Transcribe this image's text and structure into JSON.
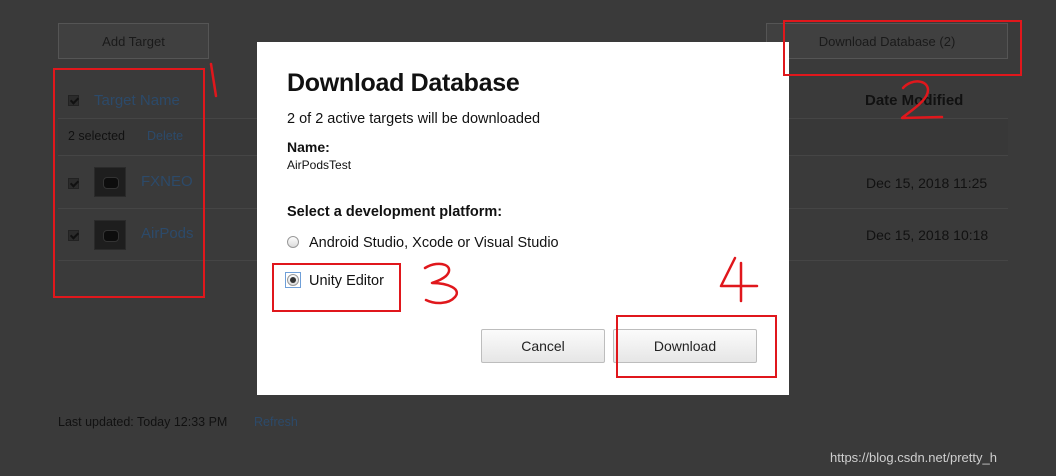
{
  "page": {
    "add_target_label": "Add Target",
    "download_database_label": "Download Database (2)",
    "column_target_name": "Target Name",
    "column_date_modified": "Date Modified",
    "selected_count": "2 selected",
    "delete_label": "Delete",
    "rows": [
      {
        "name": "FXNEO",
        "date": "Dec 15, 2018 11:25"
      },
      {
        "name": "AirPods",
        "date": "Dec 15, 2018 10:18"
      }
    ],
    "last_updated": "Last updated: Today 12:33 PM",
    "refresh_label": "Refresh"
  },
  "modal": {
    "title": "Download Database",
    "subtitle": "2 of 2 active targets will be downloaded",
    "name_label": "Name:",
    "name_value": "AirPodsTest",
    "platform_label": "Select a development platform:",
    "options": [
      {
        "label": "Android Studio, Xcode or Visual Studio",
        "selected": false
      },
      {
        "label": "Unity Editor",
        "selected": true
      }
    ],
    "cancel_label": "Cancel",
    "download_label": "Download"
  },
  "annotations": {
    "color": "#e0171c"
  },
  "watermark": "https://blog.csdn.net/pretty_h"
}
